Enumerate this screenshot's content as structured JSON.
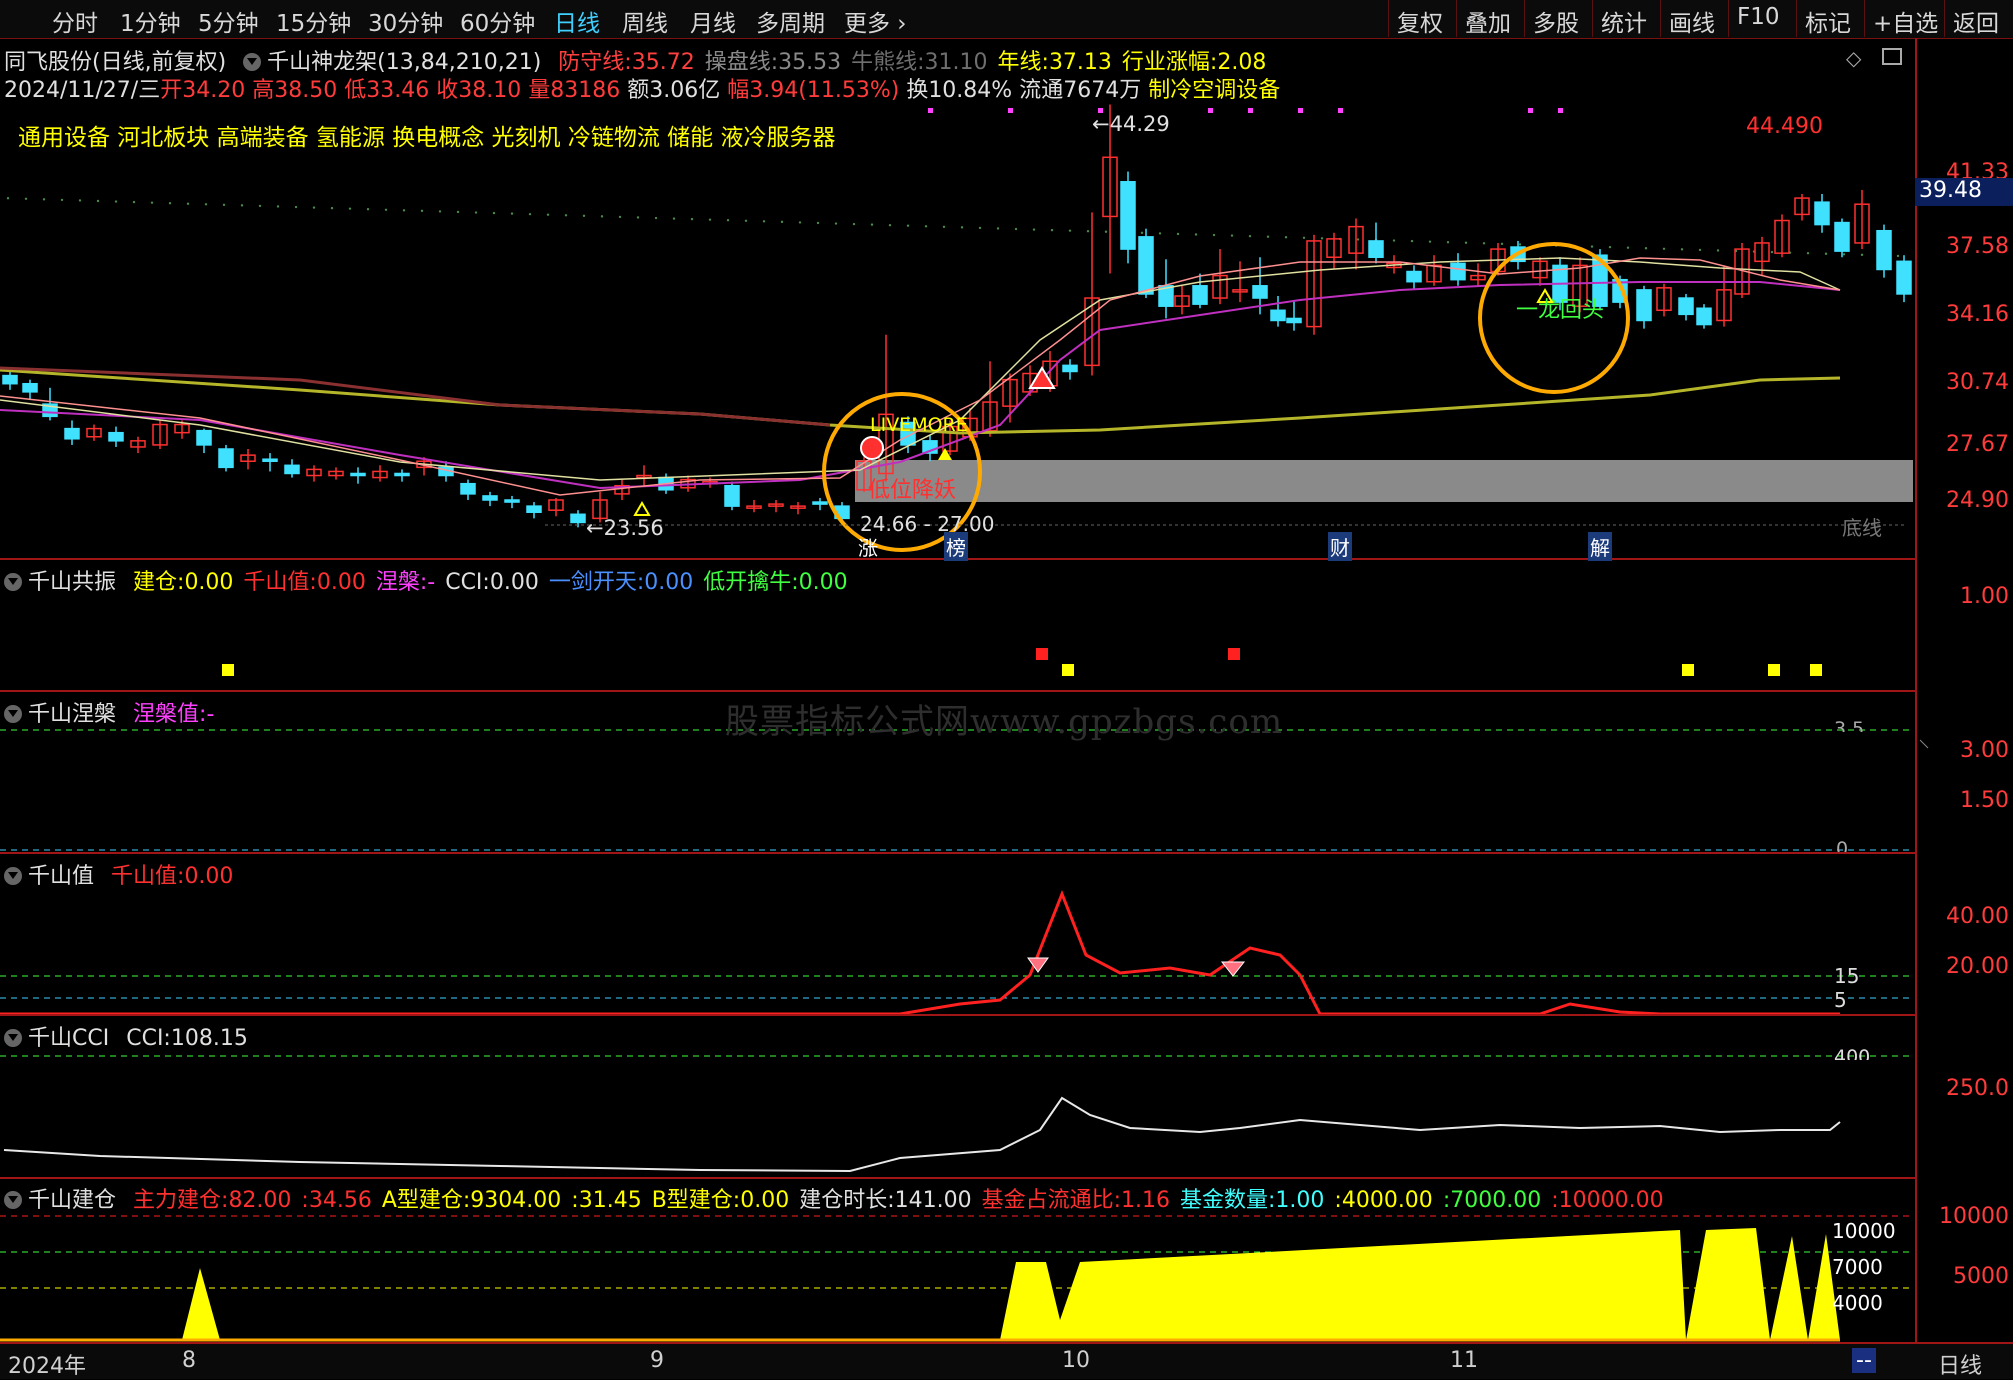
{
  "toolbar": {
    "periods": [
      "分时",
      "1分钟",
      "5分钟",
      "15分钟",
      "30分钟",
      "60分钟",
      "日线",
      "周线",
      "月线",
      "多周期",
      "更多"
    ],
    "active_period": "日线",
    "right_buttons": [
      "复权",
      "叠加",
      "多股",
      "统计",
      "画线",
      "F10",
      "标记",
      "+自选",
      "返回"
    ]
  },
  "main": {
    "stock_name": "同飞股份(日线,前复权)",
    "indicator_name": "千山神龙架(13,84,210,21)",
    "fields": [
      {
        "label": "防守线:",
        "value": "35.72",
        "color": "#ff4040"
      },
      {
        "label": "操盘线:",
        "value": "35.53",
        "color": "#8a8a8a"
      },
      {
        "label": "牛熊线:",
        "value": "31.10",
        "color": "#6f6f6f"
      },
      {
        "label": "年线:",
        "value": "37.13",
        "color": "#ffff00"
      },
      {
        "label": "行业涨幅:",
        "value": "2.08",
        "color": "#ffff00"
      }
    ],
    "quote": {
      "date": "2024/11/27/三",
      "open_label": "开",
      "open": "34.20",
      "high_label": "高",
      "high": "38.50",
      "low_label": "低",
      "low": "33.46",
      "close_label": "收",
      "close": "38.10",
      "vol_label": "量",
      "vol": "83186",
      "amt_label": "额",
      "amt": "3.06亿",
      "chg_label": "幅",
      "chg": "3.94(11.53%)",
      "turnover": "换10.84%",
      "float": "流通7674万",
      "industry": "制冷空调设备"
    },
    "concepts": "通用设备 河北板块 高端装备 氢能源 换电概念 光刻机 冷链物流 储能 液冷服务器",
    "annotations": {
      "high_price": "44.29",
      "top_right_price": "44.490",
      "low_price": "23.56",
      "range": "24.66 - 27.00",
      "livemore": "LIVEMORE",
      "low_demon": "低位降妖",
      "dragon_turn": "一龙回头",
      "bottom_line": "底线",
      "event_tags": [
        "涨",
        "榜",
        "财",
        "解"
      ]
    },
    "price_axis": [
      "41.33",
      "37.58",
      "34.16",
      "30.74",
      "27.67",
      "24.90"
    ],
    "current_price": "39.48"
  },
  "pane1": {
    "title": "千山共振",
    "fields": [
      {
        "label": "建仓:",
        "value": "0.00",
        "color": "#ffff00"
      },
      {
        "label": "千山值:",
        "value": "0.00",
        "color": "#ff3030"
      },
      {
        "label": "涅槃:",
        "value": "-",
        "color": "#ff40ff"
      },
      {
        "label": "CCI:",
        "value": "0.00",
        "color": "#e0e0e0"
      },
      {
        "label": "一剑开天:",
        "value": "0.00",
        "color": "#4a90ff"
      },
      {
        "label": "低开擒牛:",
        "value": "0.00",
        "color": "#40ff40"
      }
    ],
    "axis": [
      "1.00"
    ]
  },
  "pane2": {
    "title": "千山涅槃",
    "fields": [
      {
        "label": "涅槃值:",
        "value": "-",
        "color": "#ff40ff"
      }
    ],
    "axis": [
      "3.00",
      "1.50"
    ],
    "ref_labels": [
      "3.5",
      "0"
    ]
  },
  "pane3": {
    "title": "千山值",
    "fields": [
      {
        "label": "千山值:",
        "value": "0.00",
        "color": "#ff3030"
      }
    ],
    "axis": [
      "40.00",
      "20.00"
    ],
    "ref_labels": [
      "15",
      "5"
    ]
  },
  "pane4": {
    "title": "千山CCI",
    "fields": [
      {
        "label": "CCI:",
        "value": "108.15",
        "color": "#e0e0e0"
      }
    ],
    "axis": [
      "250.0"
    ],
    "ref_labels": [
      "400"
    ]
  },
  "pane5": {
    "title": "千山建仓",
    "fields": [
      {
        "label": "主力建仓:",
        "value": "82.00",
        "color": "#ff3030"
      },
      {
        "label": ":",
        "value": "34.56",
        "color": "#ff3030"
      },
      {
        "label": "A型建仓:",
        "value": "9304.00",
        "color": "#ffff00"
      },
      {
        "label": ":",
        "value": "31.45",
        "color": "#ffff00"
      },
      {
        "label": "B型建仓:",
        "value": "0.00",
        "color": "#ffff00"
      },
      {
        "label": "建仓时长:",
        "value": "141.00",
        "color": "#e0e0e0"
      },
      {
        "label": "基金占流通比:",
        "value": "1.16",
        "color": "#ff3030"
      },
      {
        "label": "基金数量:",
        "value": "1.00",
        "color": "#40ffff"
      },
      {
        "label": ":",
        "value": "4000.00",
        "color": "#ffff00"
      },
      {
        "label": ":",
        "value": "7000.00",
        "color": "#40ff40"
      },
      {
        "label": ":",
        "value": "10000.00",
        "color": "#ff3030"
      }
    ],
    "axis": [
      "10000",
      "5000"
    ],
    "ref_labels": [
      "10000",
      "7000",
      "4000"
    ]
  },
  "time_axis": [
    "2024年",
    "8",
    "9",
    "10",
    "11"
  ],
  "bottom_right": "日线",
  "bottom_dash": "--",
  "watermark": "股票指标公式网www.gpzbgs.com"
}
